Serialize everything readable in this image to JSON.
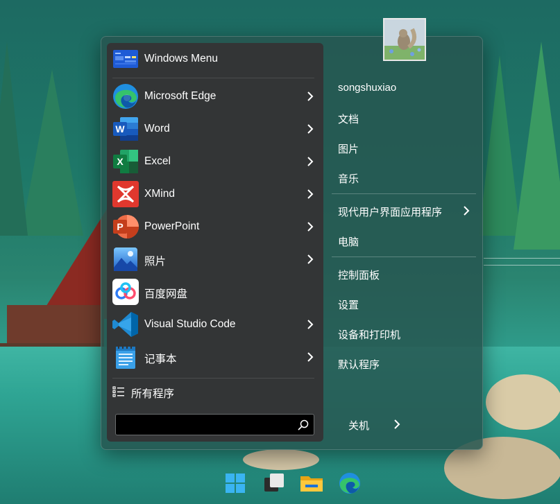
{
  "apps": [
    {
      "id": "windows-menu",
      "label": "Windows Menu",
      "has_arrow": false
    },
    {
      "id": "microsoft-edge",
      "label": "Microsoft Edge",
      "has_arrow": true
    },
    {
      "id": "word",
      "label": "Word",
      "has_arrow": true
    },
    {
      "id": "excel",
      "label": "Excel",
      "has_arrow": true
    },
    {
      "id": "xmind",
      "label": "XMind",
      "has_arrow": true
    },
    {
      "id": "powerpoint",
      "label": "PowerPoint",
      "has_arrow": true
    },
    {
      "id": "photos",
      "label": "照片",
      "has_arrow": true
    },
    {
      "id": "baidu-netdisk",
      "label": "百度网盘",
      "has_arrow": false
    },
    {
      "id": "vscode",
      "label": "Visual Studio Code",
      "has_arrow": true
    },
    {
      "id": "notepad",
      "label": "记事本",
      "has_arrow": true
    }
  ],
  "all_programs_label": "所有程序",
  "search": {
    "value": "",
    "placeholder": ""
  },
  "user": {
    "name": "songshuxiao"
  },
  "right_items": [
    {
      "id": "username",
      "label": "songshuxiao",
      "has_arrow": false
    },
    {
      "id": "documents",
      "label": "文档",
      "has_arrow": false
    },
    {
      "id": "pictures",
      "label": "图片",
      "has_arrow": false
    },
    {
      "id": "music",
      "label": "音乐",
      "has_arrow": false
    },
    {
      "id": "modern-ui-apps",
      "label": "现代用户界面应用程序",
      "has_arrow": true
    },
    {
      "id": "computer",
      "label": "电脑",
      "has_arrow": false
    },
    {
      "id": "control-panel",
      "label": "控制面板",
      "has_arrow": false
    },
    {
      "id": "settings",
      "label": "设置",
      "has_arrow": false
    },
    {
      "id": "devices-printers",
      "label": "设备和打印机",
      "has_arrow": false
    },
    {
      "id": "default-programs",
      "label": "默认程序",
      "has_arrow": false
    }
  ],
  "shutdown_label": "关机",
  "taskbar": [
    "start-icon",
    "task-view-icon",
    "file-explorer-icon",
    "edge-icon"
  ],
  "colors": {
    "left_pane": "#333536",
    "menu_bg": "#265650",
    "edge_blue": "#1f8fe0",
    "word_blue": "#2b5fb8",
    "excel_green": "#1d7a44",
    "xmind_red": "#e0382e",
    "ppt_orange": "#d24726",
    "vscode_blue": "#1f8ad2"
  }
}
